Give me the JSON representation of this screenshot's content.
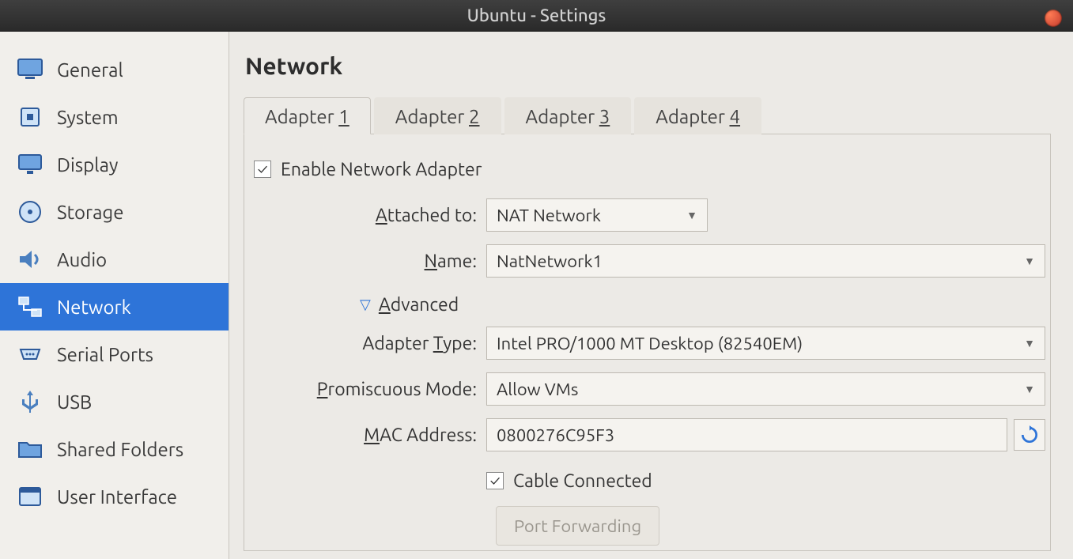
{
  "window": {
    "title": "Ubuntu - Settings"
  },
  "sidebar": {
    "items": [
      {
        "label": "General"
      },
      {
        "label": "System"
      },
      {
        "label": "Display"
      },
      {
        "label": "Storage"
      },
      {
        "label": "Audio"
      },
      {
        "label": "Network"
      },
      {
        "label": "Serial Ports"
      },
      {
        "label": "USB"
      },
      {
        "label": "Shared Folders"
      },
      {
        "label": "User Interface"
      }
    ],
    "selected_index": 5
  },
  "page": {
    "title": "Network"
  },
  "tabs": {
    "items": [
      {
        "label_prefix": "Adapter ",
        "accel": "1"
      },
      {
        "label_prefix": "Adapter ",
        "accel": "2"
      },
      {
        "label_prefix": "Adapter ",
        "accel": "3"
      },
      {
        "label_prefix": "Adapter ",
        "accel": "4"
      }
    ],
    "active_index": 0
  },
  "form": {
    "enable_checked": true,
    "enable_label_pre": "E",
    "enable_label_rest": "nable Network Adapter",
    "attached_label_pre": "A",
    "attached_label_rest": "ttached to:",
    "attached_value": "NAT Network",
    "name_label_pre": "N",
    "name_label_rest": "ame:",
    "name_value": "NatNetwork1",
    "advanced_label_pre": "A",
    "advanced_label_rest": "dvanced",
    "adapter_type_label_pre": "Adapter ",
    "adapter_type_label_accel": "T",
    "adapter_type_label_post": "ype:",
    "adapter_type_value": "Intel PRO/1000 MT Desktop (82540EM)",
    "promisc_label_pre": "P",
    "promisc_label_rest": "romiscuous Mode:",
    "promisc_value": "Allow VMs",
    "mac_label_pre": "M",
    "mac_label_rest": "AC Address:",
    "mac_value": "0800276C95F3",
    "cable_checked": true,
    "cable_label_pre": "C",
    "cable_label_rest": "able Connected",
    "port_forwarding_label": "Port Forwarding"
  },
  "icons": {
    "general_fill": "#4a7fbf",
    "selected_bg": "#2e74d8"
  }
}
